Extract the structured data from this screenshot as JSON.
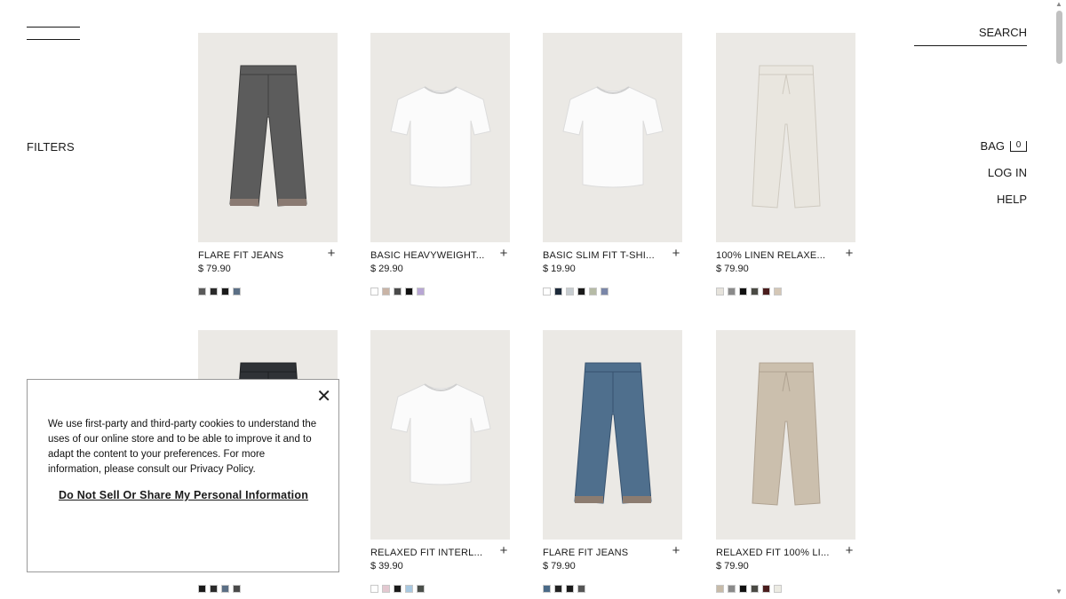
{
  "header": {
    "search_label": "SEARCH",
    "filters_label": "FILTERS",
    "bag_label": "BAG",
    "bag_count": "0",
    "login_label": "LOG IN",
    "help_label": "HELP"
  },
  "products": [
    {
      "name": "FLARE FIT JEANS",
      "price": "$ 79.90",
      "kind": "jeans-grey",
      "swatches": [
        "#5a5a5a",
        "#2a2a2a",
        "#1a1a1a",
        "#5b6f85"
      ]
    },
    {
      "name": "BASIC HEAVYWEIGHT...",
      "price": "$ 29.90",
      "kind": "tshirt",
      "swatches": [
        "#ffffff",
        "#c9b4a6",
        "#4a4a4a",
        "#111111",
        "#b8a6d4"
      ]
    },
    {
      "name": "BASIC SLIM FIT T-SHI...",
      "price": "$ 19.90",
      "kind": "tshirt",
      "swatches": [
        "#ffffff",
        "#1d2a3a",
        "#c6ccd0",
        "#1a1a1a",
        "#b6bba6",
        "#7a86a8"
      ]
    },
    {
      "name": "100% LINEN RELAXE...",
      "price": "$ 79.90",
      "kind": "pants-white",
      "swatches": [
        "#e6e3dc",
        "#8a8a8a",
        "#111111",
        "#4a4a44",
        "#4a1d1d",
        "#d4c7b6"
      ]
    },
    {
      "name": "",
      "price": "",
      "kind": "jeans-dark",
      "swatches": [
        "#1a1a1a",
        "#2a2a2a",
        "#5b6f85",
        "#4a4a4a"
      ]
    },
    {
      "name": "RELAXED FIT INTERL...",
      "price": "$ 39.90",
      "kind": "tshirt",
      "swatches": [
        "#ffffff",
        "#e3c8d0",
        "#1a1a1a",
        "#a8c8e0",
        "#4a4f4a"
      ]
    },
    {
      "name": "FLARE FIT JEANS",
      "price": "$ 79.90",
      "kind": "jeans-blue",
      "swatches": [
        "#4a6a88",
        "#222222",
        "#1a1a1a",
        "#555555"
      ]
    },
    {
      "name": "RELAXED FIT 100% LI...",
      "price": "$ 79.90",
      "kind": "pants-beige",
      "swatches": [
        "#c7bba9",
        "#8a8a8a",
        "#111111",
        "#4a4a44",
        "#4a1d1d",
        "#ecebe3"
      ]
    }
  ],
  "cookie_banner": {
    "text": "We use first-party and third-party cookies to understand the uses of our online store and to be able to improve it and to adapt the content to your preferences. For more information, please consult our",
    "privacy_link": "Privacy Policy.",
    "opt_out_link": "Do Not Sell Or Share My Personal Information"
  },
  "colors": {
    "thumb_bg": "#ebe9e5",
    "text": "#1a1a1a"
  }
}
